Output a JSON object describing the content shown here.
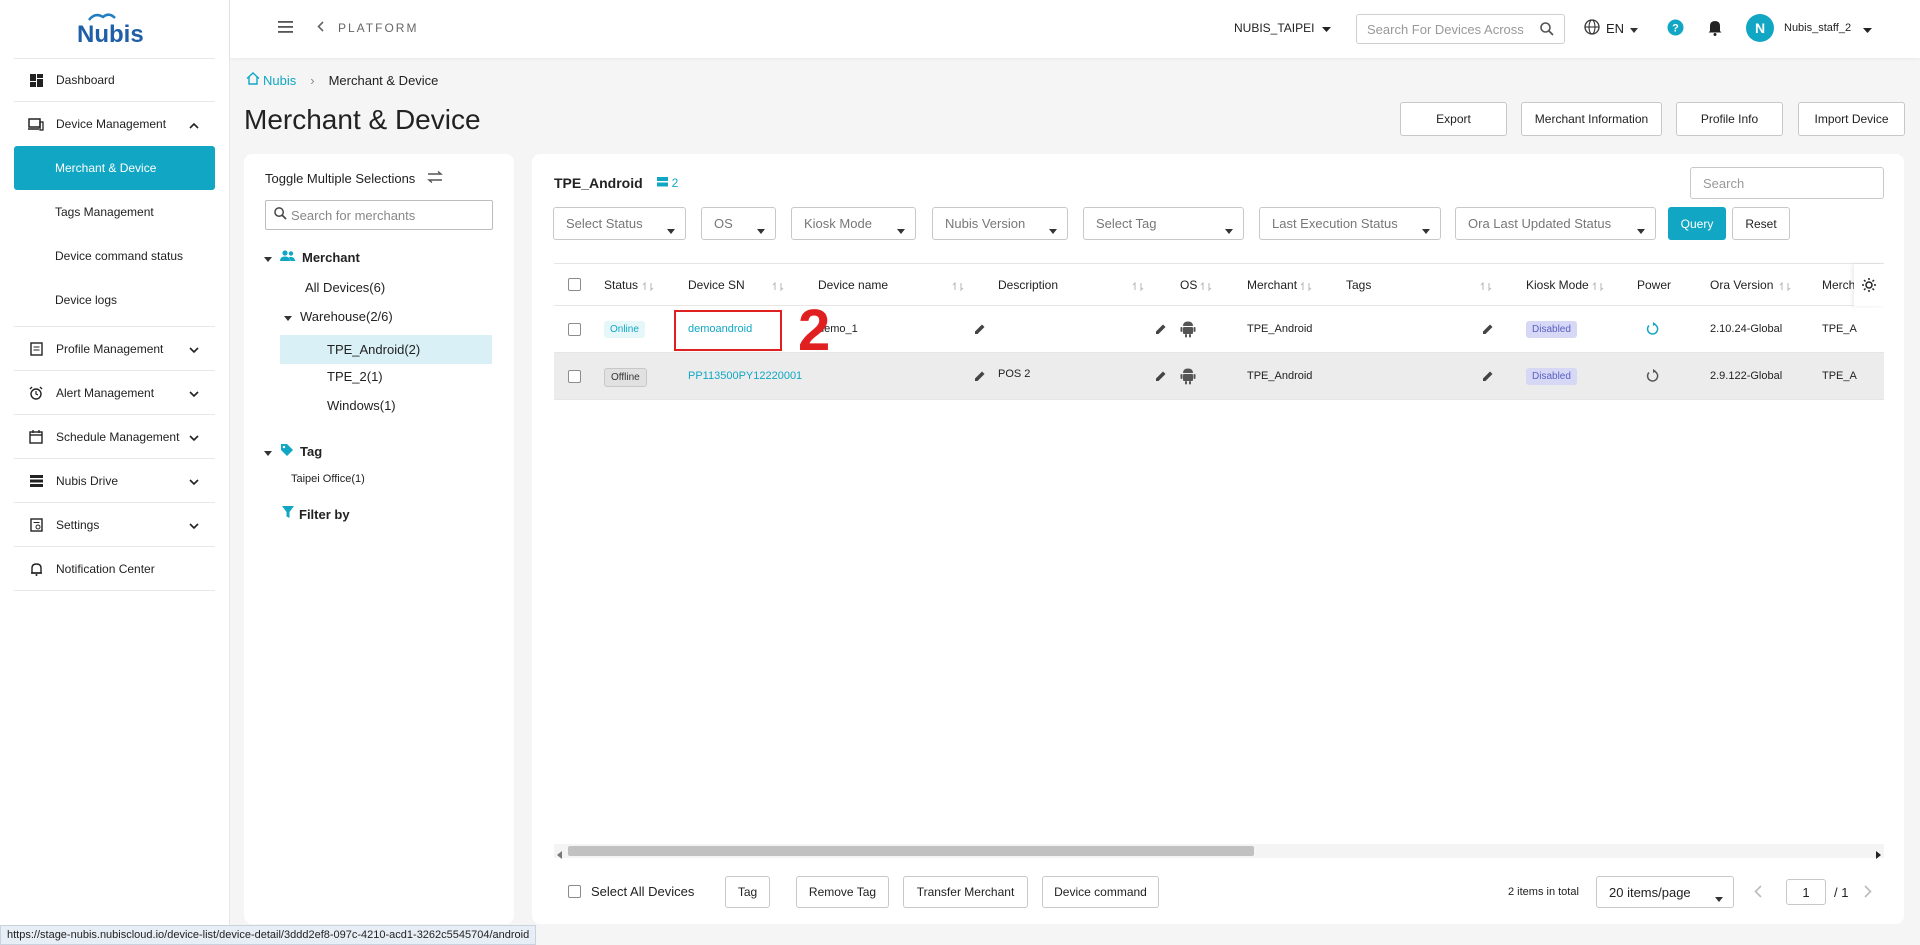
{
  "sidebar": {
    "logo_text": "Nubis",
    "items": [
      {
        "label": "Dashboard"
      },
      {
        "label": "Device Management"
      },
      {
        "label": "Profile Management"
      },
      {
        "label": "Alert Management"
      },
      {
        "label": "Schedule Management"
      },
      {
        "label": "Nubis Drive"
      },
      {
        "label": "Settings"
      },
      {
        "label": "Notification Center"
      }
    ],
    "device_sub": [
      {
        "label": "Merchant & Device",
        "active": true
      },
      {
        "label": "Tags Management"
      },
      {
        "label": "Device command status"
      },
      {
        "label": "Device logs"
      }
    ]
  },
  "topbar": {
    "platform": "PLATFORM",
    "org": "NUBIS_TAIPEI",
    "search_placeholder": "Search For Devices Across",
    "lang": "EN",
    "avatar_initial": "N",
    "username": "Nubis_staff_2"
  },
  "breadcrumb": {
    "home": "Nubis",
    "current": "Merchant & Device"
  },
  "page_title": "Merchant & Device",
  "header_buttons": {
    "export": "Export",
    "merchant_info": "Merchant Information",
    "profile_info": "Profile Info",
    "import_device": "Import Device"
  },
  "tree": {
    "toggle_label": "Toggle Multiple Selections",
    "search_placeholder": "Search for merchants",
    "merchant_header": "Merchant",
    "all_devices": "All Devices(6)",
    "warehouse": "Warehouse(2/6)",
    "tpe_android": "TPE_Android(2)",
    "tpe_2": "TPE_2(1)",
    "windows": "Windows(1)",
    "tag_header": "Tag",
    "taipei_office": "Taipei Office(1)",
    "filter_by": "Filter by"
  },
  "main": {
    "title": "TPE_Android",
    "count": "2",
    "search_placeholder": "Search",
    "filters": {
      "status": "Select Status",
      "os": "OS",
      "kiosk": "Kiosk Mode",
      "nubis_version": "Nubis Version",
      "tag": "Select Tag",
      "last_exec": "Last Execution Status",
      "ora_updated": "Ora Last Updated Status"
    },
    "query": "Query",
    "reset": "Reset"
  },
  "table": {
    "headers": {
      "status": "Status",
      "device_sn": "Device SN",
      "device_name": "Device name",
      "description": "Description",
      "os": "OS",
      "merchant": "Merchant",
      "tags": "Tags",
      "kiosk_mode": "Kiosk Mode",
      "power": "Power",
      "ora_version": "Ora Version",
      "merchant2": "Mercha"
    },
    "rows": [
      {
        "status": "Online",
        "sn": "demoandroid",
        "name": "demo_1",
        "description": "",
        "merchant": "TPE_Android",
        "kiosk": "Disabled",
        "ora": "2.10.24-Global",
        "merchant2": "TPE_A"
      },
      {
        "status": "Offline",
        "sn": "PP113500PY12220001",
        "name": "",
        "description": "POS 2",
        "merchant": "TPE_Android",
        "kiosk": "Disabled",
        "ora": "2.9.122-Global",
        "merchant2": "TPE_A"
      }
    ]
  },
  "annotation": {
    "number": "2"
  },
  "footer": {
    "select_all": "Select All Devices",
    "tag": "Tag",
    "remove_tag": "Remove Tag",
    "transfer": "Transfer Merchant",
    "command": "Device command",
    "total": "2 items in total",
    "page_size": "20 items/page",
    "page": "1",
    "page_total": "/ 1"
  },
  "status_url": "https://stage-nubis.nubiscloud.io/device-list/device-detail/3ddd2ef8-097c-4210-acd1-3262c5545704/android",
  "colors": {
    "accent": "#11a7c4",
    "annotation": "#e02020"
  }
}
